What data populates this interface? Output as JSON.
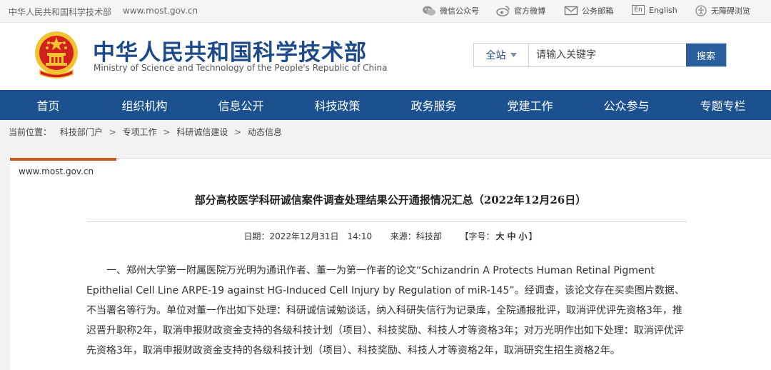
{
  "topbar": {
    "site_name": "中华人民共和国科学技术部",
    "site_url": "www.most.gov.cn",
    "wechat": "微信公众号",
    "weibo": "官方微博",
    "mail": "公务邮箱",
    "english": "English",
    "accessibility": "无障碍浏览",
    "en_icon_label": "En"
  },
  "header": {
    "title_cn": "中华人民共和国科学技术部",
    "title_en": "Ministry of Science and Technology of the People's Republic of China"
  },
  "search": {
    "scope": "全站",
    "placeholder": "请输入关键字",
    "button": "搜索"
  },
  "nav": {
    "items": [
      "首页",
      "组织机构",
      "信息公开",
      "科技政策",
      "政务服务",
      "党建工作",
      "公众参与",
      "专题专栏"
    ]
  },
  "breadcrumb": {
    "lead": "当前位置：",
    "items": [
      "科技部门户",
      "专项工作",
      "科研诚信建设",
      "动态信息"
    ],
    "separator": ">"
  },
  "article": {
    "source_url": "www.most.gov.cn",
    "title": "部分高校医学科研诚信案件调查处理结果公开通报情况汇总（2022年12月26日）",
    "date_label": "日期：",
    "date": "2022年12月31日　14:10",
    "source_label": "来源：",
    "source": "科技部",
    "font_label": "【字号：",
    "font_large": "大",
    "font_medium": "中",
    "font_small": "小",
    "font_close": "】",
    "paragraph": "一、郑州大学第一附属医院万光明为通讯作者、董一为第一作者的论文“Schizandrin A Protects Human Retinal Pigment Epithelial Cell Line ARPE-19 against HG-Induced Cell Injury by Regulation of miR-145”。经调查，该论文存在买卖图片数据、不当署名等行为。单位对董一作出如下处理：科研诚信诫勉谈话，纳入科研失信行为记录库，全院通报批评，取消评优评先资格3年，推迟晋升职称2年，取消申报财政资金支持的各级科技计划（项目）、科技奖励、科技人才等资格3年；对万光明作出如下处理：取消评优评先资格3年，取消申报财政资金支持的各级科技计划（项目）、科技奖励、科技人才等资格2年，取消研究生招生资格2年。"
  },
  "colors": {
    "brand_blue": "#1c4a8a",
    "nav_blue": "#1c5190",
    "accent_orange": "#c9581e",
    "emblem_red": "#d2201e",
    "emblem_gold": "#f2c230"
  }
}
